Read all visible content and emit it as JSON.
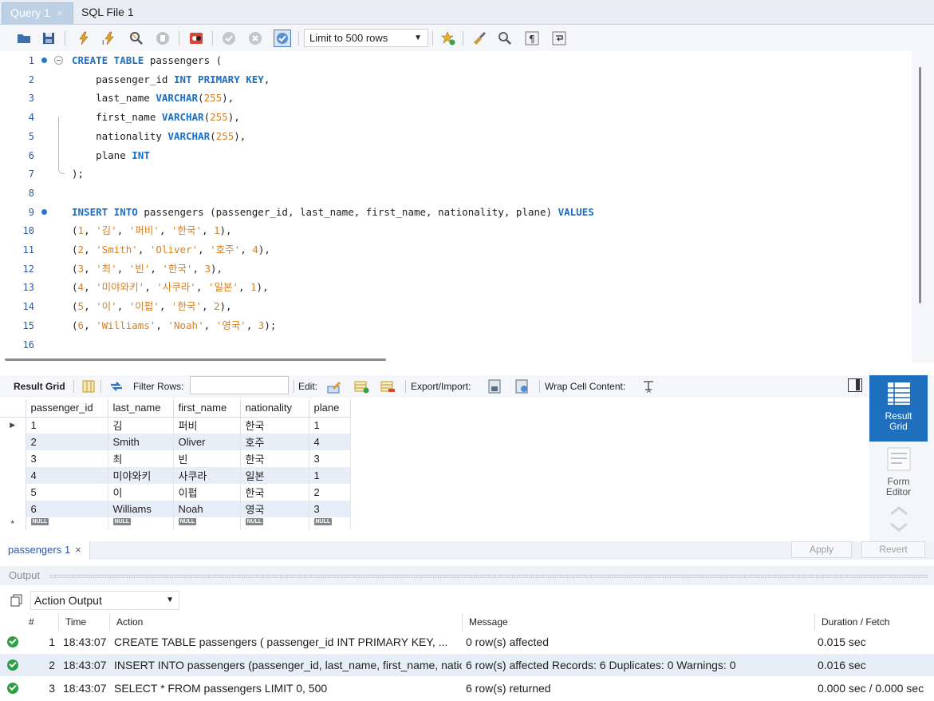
{
  "tabs": [
    {
      "label": "Query 1",
      "close": "×"
    },
    {
      "label": "SQL File 1"
    }
  ],
  "toolbar": {
    "limit_label": "Limit to 500 rows"
  },
  "editor": {
    "lines": [
      {
        "n": "1",
        "dot": true,
        "tokens": [
          [
            "kw",
            "CREATE TABLE"
          ],
          [
            "t",
            " passengers ("
          ]
        ]
      },
      {
        "n": "2",
        "tokens": [
          [
            "t",
            "    passenger_id "
          ],
          [
            "kw",
            "INT PRIMARY KEY"
          ],
          [
            "t",
            ","
          ]
        ]
      },
      {
        "n": "3",
        "tokens": [
          [
            "t",
            "    last_name "
          ],
          [
            "kw",
            "VARCHAR"
          ],
          [
            "t",
            "("
          ],
          [
            "num",
            "255"
          ],
          [
            "t",
            "),"
          ]
        ]
      },
      {
        "n": "4",
        "tokens": [
          [
            "t",
            "    first_name "
          ],
          [
            "kw",
            "VARCHAR"
          ],
          [
            "t",
            "("
          ],
          [
            "num",
            "255"
          ],
          [
            "t",
            "),"
          ]
        ]
      },
      {
        "n": "5",
        "tokens": [
          [
            "t",
            "    nationality "
          ],
          [
            "kw",
            "VARCHAR"
          ],
          [
            "t",
            "("
          ],
          [
            "num",
            "255"
          ],
          [
            "t",
            "),"
          ]
        ]
      },
      {
        "n": "6",
        "tokens": [
          [
            "t",
            "    plane "
          ],
          [
            "kw",
            "INT"
          ]
        ]
      },
      {
        "n": "7",
        "tokens": [
          [
            "t",
            ");"
          ]
        ]
      },
      {
        "n": "8",
        "tokens": []
      },
      {
        "n": "9",
        "dot": true,
        "tokens": [
          [
            "kw",
            "INSERT INTO"
          ],
          [
            "t",
            " passengers (passenger_id, last_name, first_name, nationality, plane) "
          ],
          [
            "kw",
            "VALUES"
          ]
        ]
      },
      {
        "n": "10",
        "tokens": [
          [
            "t",
            "("
          ],
          [
            "num",
            "1"
          ],
          [
            "t",
            ", "
          ],
          [
            "str",
            "'김'"
          ],
          [
            "t",
            ", "
          ],
          [
            "str",
            "'퍼비'"
          ],
          [
            "t",
            ", "
          ],
          [
            "str",
            "'한국'"
          ],
          [
            "t",
            ", "
          ],
          [
            "num",
            "1"
          ],
          [
            "t",
            "),"
          ]
        ]
      },
      {
        "n": "11",
        "tokens": [
          [
            "t",
            "("
          ],
          [
            "num",
            "2"
          ],
          [
            "t",
            ", "
          ],
          [
            "str",
            "'Smith'"
          ],
          [
            "t",
            ", "
          ],
          [
            "str",
            "'Oliver'"
          ],
          [
            "t",
            ", "
          ],
          [
            "str",
            "'호주'"
          ],
          [
            "t",
            ", "
          ],
          [
            "num",
            "4"
          ],
          [
            "t",
            "),"
          ]
        ]
      },
      {
        "n": "12",
        "tokens": [
          [
            "t",
            "("
          ],
          [
            "num",
            "3"
          ],
          [
            "t",
            ", "
          ],
          [
            "str",
            "'최'"
          ],
          [
            "t",
            ", "
          ],
          [
            "str",
            "'빈'"
          ],
          [
            "t",
            ", "
          ],
          [
            "str",
            "'한국'"
          ],
          [
            "t",
            ", "
          ],
          [
            "num",
            "3"
          ],
          [
            "t",
            "),"
          ]
        ]
      },
      {
        "n": "13",
        "tokens": [
          [
            "t",
            "("
          ],
          [
            "num",
            "4"
          ],
          [
            "t",
            ", "
          ],
          [
            "str",
            "'미야와키'"
          ],
          [
            "t",
            ", "
          ],
          [
            "str",
            "'사쿠라'"
          ],
          [
            "t",
            ", "
          ],
          [
            "str",
            "'일본'"
          ],
          [
            "t",
            ", "
          ],
          [
            "num",
            "1"
          ],
          [
            "t",
            "),"
          ]
        ]
      },
      {
        "n": "14",
        "tokens": [
          [
            "t",
            "("
          ],
          [
            "num",
            "5"
          ],
          [
            "t",
            ", "
          ],
          [
            "str",
            "'이'"
          ],
          [
            "t",
            ", "
          ],
          [
            "str",
            "'이펍'"
          ],
          [
            "t",
            ", "
          ],
          [
            "str",
            "'한국'"
          ],
          [
            "t",
            ", "
          ],
          [
            "num",
            "2"
          ],
          [
            "t",
            "),"
          ]
        ]
      },
      {
        "n": "15",
        "tokens": [
          [
            "t",
            "("
          ],
          [
            "num",
            "6"
          ],
          [
            "t",
            ", "
          ],
          [
            "str",
            "'Williams'"
          ],
          [
            "t",
            ", "
          ],
          [
            "str",
            "'Noah'"
          ],
          [
            "t",
            ", "
          ],
          [
            "str",
            "'영국'"
          ],
          [
            "t",
            ", "
          ],
          [
            "num",
            "3"
          ],
          [
            "t",
            ");"
          ]
        ]
      },
      {
        "n": "16",
        "tokens": []
      }
    ]
  },
  "result_toolbar": {
    "result_grid": "Result Grid",
    "filter_rows": "Filter Rows:",
    "edit": "Edit:",
    "export_import": "Export/Import:",
    "wrap": "Wrap Cell Content:"
  },
  "grid": {
    "columns": [
      "passenger_id",
      "last_name",
      "first_name",
      "nationality",
      "plane"
    ],
    "rows": [
      [
        "1",
        "김",
        "퍼비",
        "한국",
        "1"
      ],
      [
        "2",
        "Smith",
        "Oliver",
        "호주",
        "4"
      ],
      [
        "3",
        "최",
        "빈",
        "한국",
        "3"
      ],
      [
        "4",
        "미야와키",
        "사쿠라",
        "일본",
        "1"
      ],
      [
        "5",
        "이",
        "이펍",
        "한국",
        "2"
      ],
      [
        "6",
        "Williams",
        "Noah",
        "영국",
        "3"
      ]
    ],
    "null_label": "NULL",
    "new_row_marker": "*"
  },
  "side_panel": {
    "result_grid": "Result Grid",
    "form_editor": "Form Editor"
  },
  "result_tabs": {
    "tab_label": "passengers 1",
    "close": "×",
    "apply": "Apply",
    "revert": "Revert"
  },
  "output": {
    "title": "Output",
    "selector": "Action Output",
    "columns": {
      "num": "#",
      "time": "Time",
      "action": "Action",
      "message": "Message",
      "duration": "Duration / Fetch"
    },
    "rows": [
      {
        "n": "1",
        "time": "18:43:07",
        "action": "CREATE TABLE passengers (     passenger_id INT PRIMARY KEY,     ...",
        "message": "0 row(s) affected",
        "duration": "0.015 sec"
      },
      {
        "n": "2",
        "time": "18:43:07",
        "action": "INSERT INTO passengers (passenger_id, last_name, first_name, natio...",
        "message": "6 row(s) affected Records: 6  Duplicates: 0  Warnings: 0",
        "duration": "0.016 sec"
      },
      {
        "n": "3",
        "time": "18:43:07",
        "action": "SELECT * FROM passengers LIMIT 0, 500",
        "message": "6 row(s) returned",
        "duration": "0.000 sec / 0.000 sec"
      }
    ]
  }
}
